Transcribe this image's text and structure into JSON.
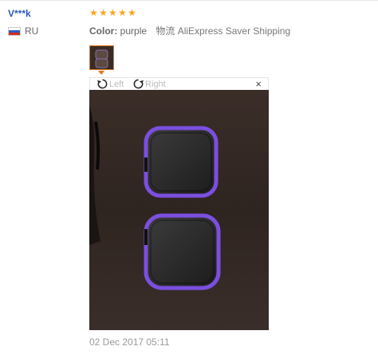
{
  "review": {
    "user": "V***k",
    "country": "RU",
    "rating": 5,
    "color_label": "Color:",
    "color_value": "purple",
    "shipping": "物流 AliExpress Saver Shipping",
    "date": "02 Dec 2017 05:11"
  },
  "viewer": {
    "rotate_left": "Left",
    "rotate_right": "Right",
    "close": "×"
  },
  "colors": {
    "accent": "#e8761c",
    "star": "#f5a623",
    "link": "#2b5ab8",
    "case_trim": "#7b4fe0"
  },
  "icons": [
    "rotate-left-icon",
    "rotate-right-icon",
    "close-icon",
    "star-icon",
    "flag-ru-icon"
  ]
}
